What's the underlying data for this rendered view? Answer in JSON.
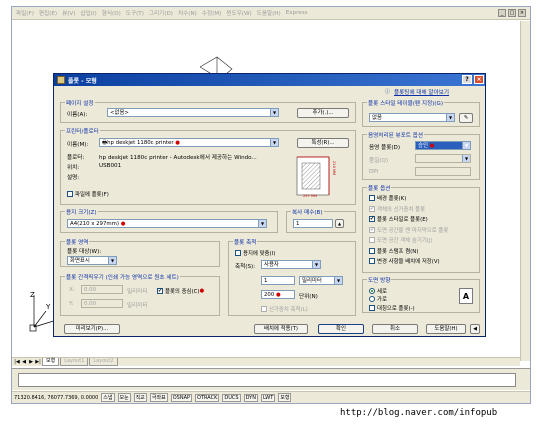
{
  "menubar": {
    "items": [
      "파일(F)",
      "편집(E)",
      "뷰(V)",
      "삽입(I)",
      "형식(O)",
      "도구(T)",
      "그리기(D)",
      "치수(N)",
      "수정(M)",
      "윈도우(W)",
      "도움말(H)",
      "Express"
    ]
  },
  "tabs": {
    "model": "모형",
    "layout1": "Layout1",
    "layout2": "Layout2"
  },
  "ucs": {
    "x": "X",
    "y": "Y",
    "z": "Z"
  },
  "statusbar": {
    "coords": "71320.8416, 76077.7369, 0.0000",
    "toggles": [
      "스냅",
      "모눈",
      "직교",
      "극좌표",
      "OSNAP",
      "OTRACK",
      "DUCS",
      "DYN",
      "LWT",
      "모형"
    ]
  },
  "watermark": "http://blog.naver.com/infopub",
  "dialog": {
    "title": "플롯 - 모형",
    "help_link": "플롯팅에 대해 알아보기",
    "page_setup": {
      "label": "페이지 설정",
      "name_label": "이름(A):",
      "name_value": "<없음>",
      "add_button": "추가(.)..."
    },
    "printer": {
      "label": "프린터/플로터",
      "name_label": "이름(M):",
      "name_value": "hp deskjet 1180c printer",
      "properties_button": "특성(R)...",
      "plotter_label": "플로터:",
      "plotter_value": "hp deskjet 1180c printer - Autodesk에서 제공하는 Windo...",
      "where_label": "위치:",
      "where_value": "USB001",
      "desc_label": "설명:",
      "plot_to_file": "파일에 플롯(F)",
      "preview_dim_h": "210 MM",
      "preview_dim_w": "297 MM"
    },
    "paper_size": {
      "label": "용지 크기(Z)",
      "value": "A4(210 x 297mm)"
    },
    "copies": {
      "label": "복사 매수(B)",
      "value": "1"
    },
    "plot_area": {
      "label": "플롯 영역",
      "what_label": "플롯 대상(W):",
      "what_value": "화면표시"
    },
    "plot_offset": {
      "label": "플롯 간격띄우기 (인쇄 가능 영역으로 원초 세트)",
      "x_label": "X:",
      "x_value": "0.00",
      "x_unit": "밀리미터",
      "y_label": "Y:",
      "y_value": "0.00",
      "y_unit": "밀리미터",
      "center": "플롯의 중심(C)"
    },
    "plot_scale": {
      "label": "플롯 축척",
      "fit": "용지에 맞춤(I)",
      "scale_label": "축척(S):",
      "scale_value": "사용자",
      "num_value": "1",
      "num_unit": "밀리미터",
      "den_value": "200",
      "den_unit": "단위(N)",
      "lineweights": "선가중치 축척(L)"
    },
    "plot_style_table": {
      "label": "플롯 스타일 테이블(펜 지정)(G)",
      "value": "없음"
    },
    "shaded_viewport": {
      "label": "음영처리된 뷰포트 옵션",
      "shade_label": "음영 플롯(D)",
      "shade_value": "승인",
      "quality_label": "품질(Q)",
      "dpi_label": "DPI"
    },
    "plot_options": {
      "label": "플롯 옵션",
      "items": [
        {
          "text": "배경 플롯(K)",
          "checked": false,
          "disabled": false
        },
        {
          "text": "객체의 선가중치 플롯",
          "checked": true,
          "disabled": true
        },
        {
          "text": "플롯 스타일로 플롯(E)",
          "checked": true,
          "disabled": false
        },
        {
          "text": "도면 공간을 맨 마지막으로 플롯",
          "checked": true,
          "disabled": true
        },
        {
          "text": "도면 공간 객체 숨기기(J)",
          "checked": false,
          "disabled": true
        },
        {
          "text": "플롯 스탬프 켬(N)",
          "checked": false,
          "disabled": false
        },
        {
          "text": "변경 사항을 배치에 저장(V)",
          "checked": false,
          "disabled": false
        }
      ]
    },
    "orientation": {
      "label": "도면 방향",
      "portrait": "세로",
      "landscape": "가로",
      "upside_down": "대칭으로 플롯(-)"
    },
    "buttons": {
      "preview": "미리보기(P)...",
      "apply": "배치에 적용(T)",
      "ok": "확인",
      "cancel": "취소",
      "help": "도움말(H)"
    }
  }
}
